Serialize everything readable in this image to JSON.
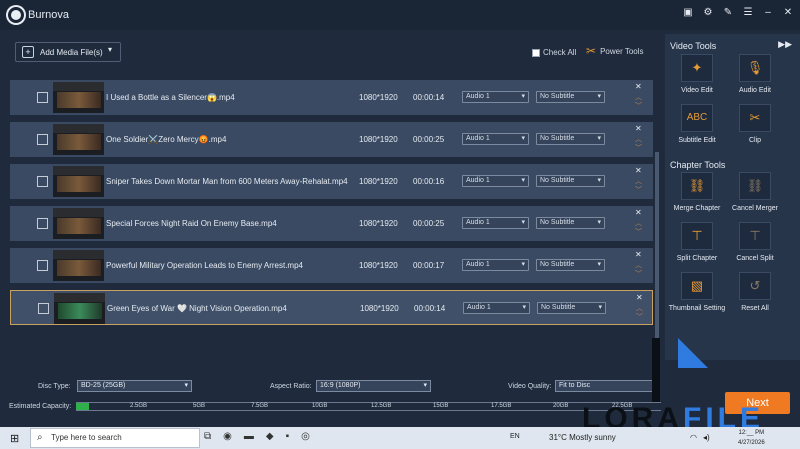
{
  "app": {
    "title": "Burnova"
  },
  "toolbar": {
    "add_media_label": "Add Media File(s)",
    "check_all_label": "Check All",
    "power_tools_label": "Power Tools"
  },
  "files": [
    {
      "name": "I Used a Bottle as a Silencer😱.mp4",
      "resolution": "1080*1920",
      "duration": "00:00:14",
      "audio": "Audio 1",
      "subtitle": "No Subtitle"
    },
    {
      "name": "One Soldier⚔️Zero Mercy😡.mp4",
      "resolution": "1080*1920",
      "duration": "00:00:25",
      "audio": "Audio 1",
      "subtitle": "No Subtitle"
    },
    {
      "name": "Sniper Takes Down Mortar Man from 600 Meters Away-Rehalat.mp4",
      "resolution": "1080*1920",
      "duration": "00:00:16",
      "audio": "Audio 1",
      "subtitle": "No Subtitle"
    },
    {
      "name": "Special Forces Night Raid On Enemy Base.mp4",
      "resolution": "1080*1920",
      "duration": "00:00:25",
      "audio": "Audio 1",
      "subtitle": "No Subtitle"
    },
    {
      "name": "Powerful Military Operation Leads to Enemy Arrest.mp4",
      "resolution": "1080*1920",
      "duration": "00:00:17",
      "audio": "Audio 1",
      "subtitle": "No Subtitle"
    },
    {
      "name": "Green Eyes of War 🤍 Night Vision Operation.mp4",
      "resolution": "1080*1920",
      "duration": "00:00:14",
      "audio": "Audio 1",
      "subtitle": "No Subtitle"
    }
  ],
  "sidebar": {
    "video_tools_header": "Video Tools",
    "video_tools": [
      {
        "label": "Video Edit",
        "icon": "magic-wand-icon"
      },
      {
        "label": "Audio Edit",
        "icon": "microphone-icon"
      },
      {
        "label": "Subtitle Edit",
        "icon": "abc-icon"
      },
      {
        "label": "Clip",
        "icon": "scissors-icon"
      }
    ],
    "chapter_tools_header": "Chapter Tools",
    "chapter_tools": [
      {
        "label": "Merge Chapter",
        "icon": "link-icon"
      },
      {
        "label": "Cancel Merger",
        "icon": "broken-link-icon"
      },
      {
        "label": "Split Chapter",
        "icon": "split-icon"
      },
      {
        "label": "Cancel Split",
        "icon": "cancel-split-icon"
      },
      {
        "label": "Thumbnail Setting",
        "icon": "image-icon"
      },
      {
        "label": "Reset All",
        "icon": "reset-icon"
      }
    ]
  },
  "bottom": {
    "disc_type_label": "Disc Type:",
    "disc_type_value": "BD-25 (25GB)",
    "aspect_ratio_label": "Aspect Ratio:",
    "aspect_ratio_value": "16:9 (1080P)",
    "video_quality_label": "Video Quality:",
    "video_quality_value": "Fit to Disc",
    "capacity_label": "Estimated Capacity:",
    "capacity_ticks": [
      "2.5GB",
      "5GB",
      "7.5GB",
      "10GB",
      "12.5GB",
      "15GB",
      "17.5GB",
      "20GB",
      "22.5GB"
    ],
    "capacity_used_fraction": 0.022,
    "next_label": "Next"
  },
  "watermark": {
    "text_a": "LORA",
    "text_b": "FILE"
  },
  "taskbar": {
    "search_placeholder": "Type here to search",
    "language": "EN",
    "weather": "31°C  Mostly sunny",
    "time": "12:__ PM",
    "date": "4/27/2026"
  },
  "colors": {
    "accent": "#f07a22",
    "icon_orange": "#e69a36",
    "selection_border": "#c8a060",
    "capacity_fill": "#2fb04a"
  }
}
